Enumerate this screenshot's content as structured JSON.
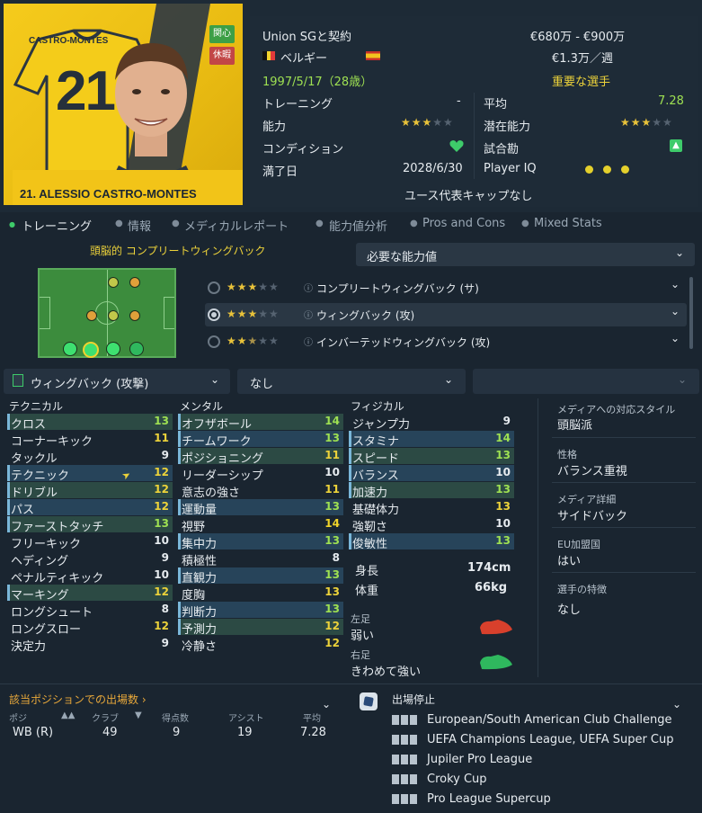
{
  "player": {
    "name_bar": "21. ALESSIO CASTRO-MONTES",
    "shirt_name": "CASTRO-MONTES",
    "shirt_number": "21",
    "tag_interest": "関心",
    "tag_rest": "休暇"
  },
  "info": {
    "contract_label": "Union SGと契約",
    "value_range": "€680万 - €900万",
    "nationality": "ベルギー",
    "wage": "€1.3万／週",
    "birth": "1997/5/17（28歳）",
    "status": "重要な選手",
    "training_label": "トレーニング",
    "training_value": "-",
    "average_label": "平均",
    "average_value": "7.28",
    "ability_label": "能力",
    "ability_stars": 3,
    "potential_label": "潜在能力",
    "potential_stars": 3,
    "condition_label": "コンディション",
    "match_fitness_label": "試合勘",
    "expiry_label": "満了日",
    "expiry_value": "2028/6/30",
    "playeriq_label": "Player IQ",
    "youth_caps": "ユース代表キャップなし"
  },
  "tabs": [
    "トレーニング",
    "情報",
    "メディカルレポート",
    "能力値分析",
    "Pros and Cons",
    "Mixed Stats"
  ],
  "tactics": {
    "role_label": "頭脳的 コンプリートウィングバック",
    "need_attr_label": "必要な能力値",
    "roles": [
      {
        "label": "コンプリートウィングバック (サ)",
        "stars": 3
      },
      {
        "label": "ウィングバック (攻)",
        "stars": 3
      },
      {
        "label": "インバーテッドウィングバック (攻)",
        "stars": 2.5
      }
    ]
  },
  "selects": {
    "role": "ウィングバック (攻撃)",
    "second": "なし",
    "third": ""
  },
  "attributes": {
    "technical_title": "テクニカル",
    "mental_title": "メンタル",
    "physical_title": "フィジカル",
    "technical": [
      {
        "name": "クロス",
        "value": "13"
      },
      {
        "name": "コーナーキック",
        "value": "11"
      },
      {
        "name": "タックル",
        "value": "9"
      },
      {
        "name": "テクニック",
        "value": "12"
      },
      {
        "name": "ドリブル",
        "value": "12"
      },
      {
        "name": "パス",
        "value": "12"
      },
      {
        "name": "ファーストタッチ",
        "value": "13"
      },
      {
        "name": "フリーキック",
        "value": "10"
      },
      {
        "name": "ヘディング",
        "value": "9"
      },
      {
        "name": "ペナルティキック",
        "value": "10"
      },
      {
        "name": "マーキング",
        "value": "12"
      },
      {
        "name": "ロングシュート",
        "value": "8"
      },
      {
        "name": "ロングスロー",
        "value": "12"
      },
      {
        "name": "決定力",
        "value": "9"
      }
    ],
    "mental": [
      {
        "name": "オフザボール",
        "value": "14"
      },
      {
        "name": "チームワーク",
        "value": "13"
      },
      {
        "name": "ポジショニング",
        "value": "11"
      },
      {
        "name": "リーダーシップ",
        "value": "10"
      },
      {
        "name": "意志の強さ",
        "value": "11"
      },
      {
        "name": "運動量",
        "value": "13"
      },
      {
        "name": "視野",
        "value": "14"
      },
      {
        "name": "集中力",
        "value": "13"
      },
      {
        "name": "積極性",
        "value": "8"
      },
      {
        "name": "直観力",
        "value": "13"
      },
      {
        "name": "度胸",
        "value": "13"
      },
      {
        "name": "判断力",
        "value": "13"
      },
      {
        "name": "予測力",
        "value": "12"
      },
      {
        "name": "冷静さ",
        "value": "12"
      }
    ],
    "physical": [
      {
        "name": "ジャンプ力",
        "value": "9"
      },
      {
        "name": "スタミナ",
        "value": "14"
      },
      {
        "name": "スピード",
        "value": "13"
      },
      {
        "name": "バランス",
        "value": "10"
      },
      {
        "name": "加速力",
        "value": "13"
      },
      {
        "name": "基礎体力",
        "value": "13"
      },
      {
        "name": "強靭さ",
        "value": "10"
      },
      {
        "name": "俊敏性",
        "value": "13"
      }
    ],
    "height_label": "身長",
    "height_value": "174cm",
    "weight_label": "体重",
    "weight_value": "66kg",
    "left_foot_label": "左足",
    "left_foot_value": "弱い",
    "right_foot_label": "右足",
    "right_foot_value": "きわめて強い"
  },
  "side": {
    "media_label": "メディアへの対応スタイル",
    "media_value": "頭脳派",
    "personality_label": "性格",
    "personality_value": "バランス重視",
    "media_detail_label": "メディア詳細",
    "media_detail_value": "サイドバック",
    "eu_label": "EU加盟国",
    "eu_value": "はい",
    "traits_label": "選手の特徴",
    "traits_value": "なし"
  },
  "appearances": {
    "title": "該当ポジションでの出場数",
    "headers": [
      "ポジ",
      "クラブ",
      "得点数",
      "アシスト",
      "平均"
    ],
    "row": [
      "WB (R)",
      "49",
      "9",
      "19",
      "7.28"
    ]
  },
  "bans": {
    "title": "出場停止",
    "competitions": [
      "European/South American Club Challenge",
      "UEFA Champions League, UEFA Super Cup",
      "Jupiler Pro League",
      "Croky Cup",
      "Pro League Supercup"
    ]
  },
  "colors": {
    "accent_yellow": "#ecd23a",
    "accent_green": "#9ee052",
    "shirt_yellow": "#f2c418",
    "red_boot": "#d8402c",
    "green_boot": "#2fb85e"
  }
}
